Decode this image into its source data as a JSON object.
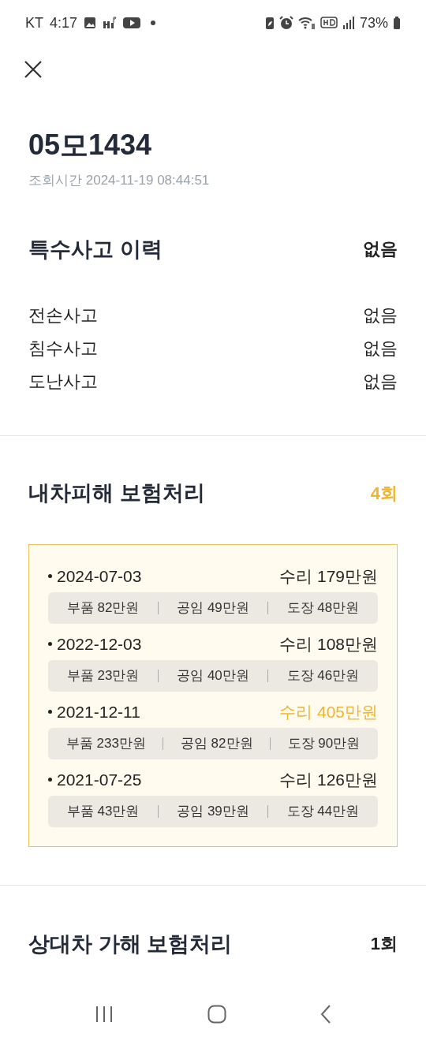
{
  "status_bar": {
    "carrier": "KT",
    "time": "4:17",
    "battery": "73%"
  },
  "plate": "05모1434",
  "lookup_time": "조회시간 2024-11-19 08:44:51",
  "special_accidents": {
    "title": "특수사고 이력",
    "summary": "없음",
    "rows": [
      {
        "label": "전손사고",
        "value": "없음"
      },
      {
        "label": "침수사고",
        "value": "없음"
      },
      {
        "label": "도난사고",
        "value": "없음"
      }
    ]
  },
  "own_damage": {
    "title": "내차피해 보험처리",
    "count": "4회",
    "highlight_count": true,
    "claims": [
      {
        "date": "2024-07-03",
        "total": "수리 179만원",
        "highlight": false,
        "parts": [
          "부품 82만원",
          "공임 49만원",
          "도장 48만원"
        ]
      },
      {
        "date": "2022-12-03",
        "total": "수리 108만원",
        "highlight": false,
        "parts": [
          "부품 23만원",
          "공임 40만원",
          "도장 46만원"
        ]
      },
      {
        "date": "2021-12-11",
        "total": "수리 405만원",
        "highlight": true,
        "parts": [
          "부품 233만원",
          "공임 82만원",
          "도장 90만원"
        ]
      },
      {
        "date": "2021-07-25",
        "total": "수리 126만원",
        "highlight": false,
        "parts": [
          "부품 43만원",
          "공임 39만원",
          "도장 44만원"
        ]
      }
    ]
  },
  "other_damage": {
    "title": "상대차 가해 보험처리",
    "count": "1회",
    "highlight_count": false
  }
}
